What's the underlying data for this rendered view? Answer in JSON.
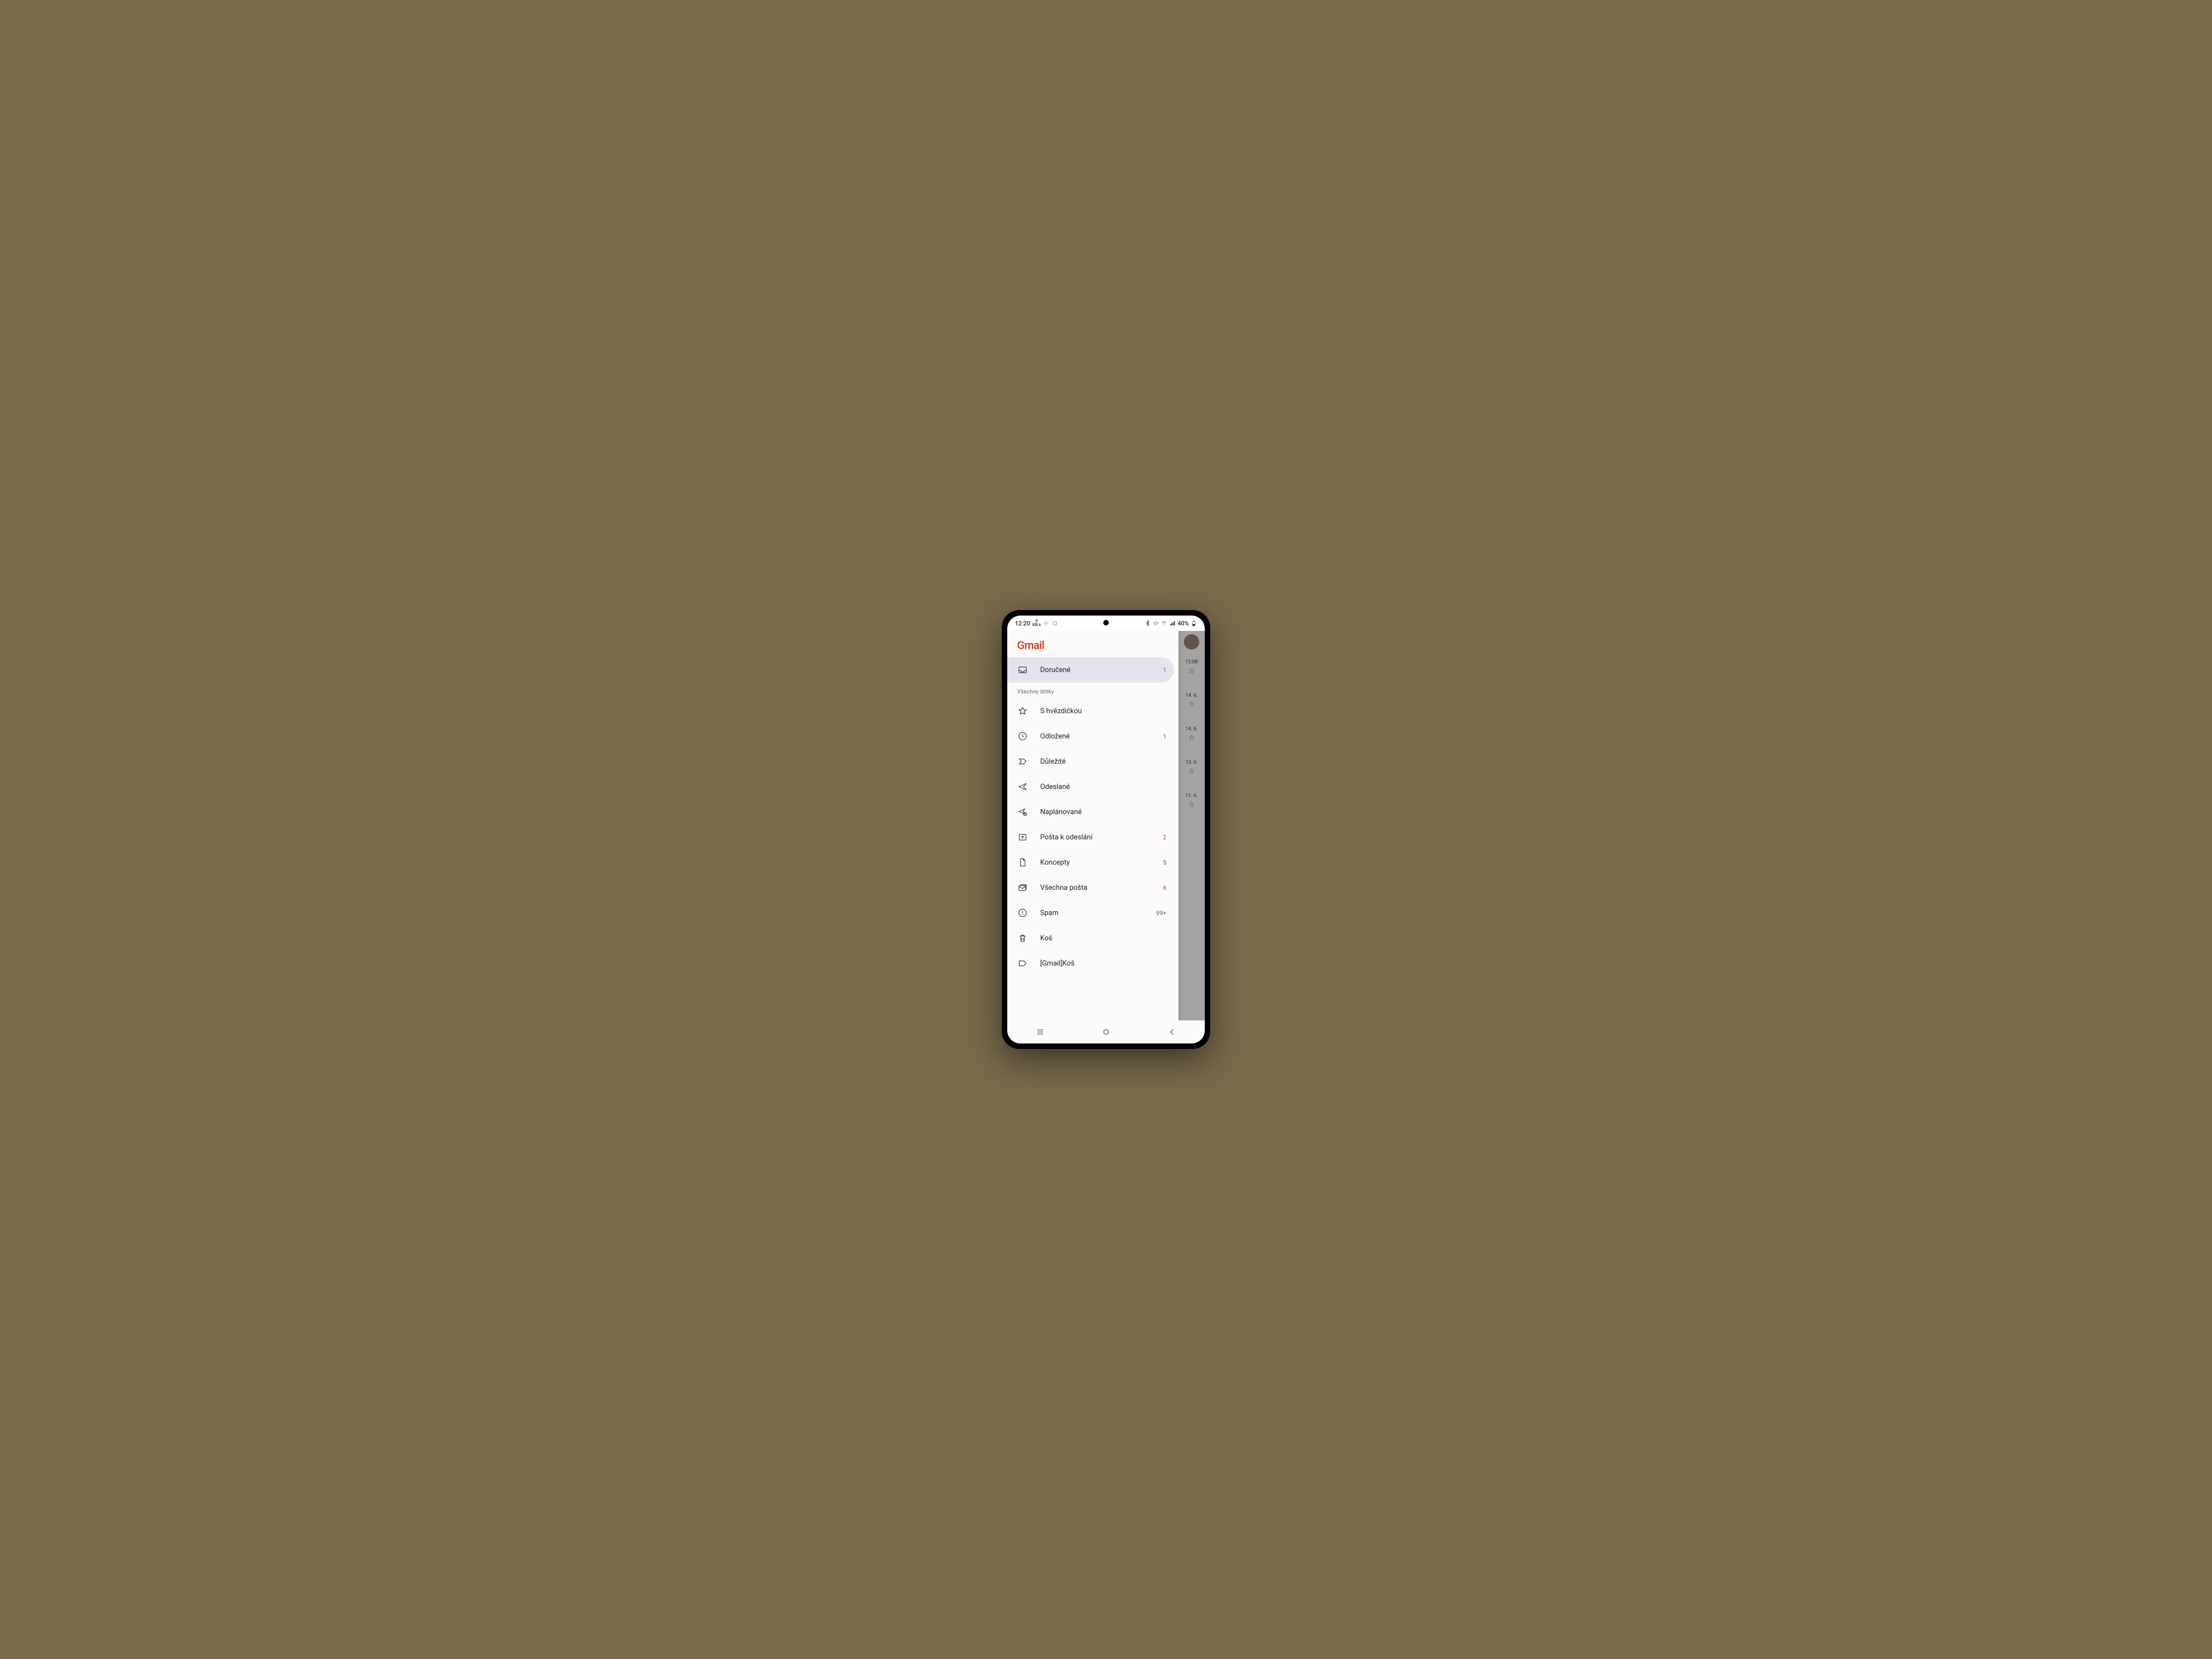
{
  "status": {
    "time": "12:20",
    "net_speed_value": "0",
    "net_speed_unit": "KB/s",
    "battery_text": "40%"
  },
  "app": {
    "title": "Gmail"
  },
  "drawer": {
    "primary": {
      "icon": "inbox-icon",
      "label": "Doručené",
      "count": "1"
    },
    "section_label": "Všechny štítky",
    "items": [
      {
        "icon": "star-icon",
        "label": "S hvězdičkou",
        "count": ""
      },
      {
        "icon": "clock-icon",
        "label": "Odložené",
        "count": "1"
      },
      {
        "icon": "important-icon",
        "label": "Důležité",
        "count": ""
      },
      {
        "icon": "send-icon",
        "label": "Odeslané",
        "count": ""
      },
      {
        "icon": "schedule-send-icon",
        "label": "Naplánované",
        "count": ""
      },
      {
        "icon": "outbox-icon",
        "label": "Pošta k odeslání",
        "count": "2",
        "alert": true
      },
      {
        "icon": "draft-icon",
        "label": "Koncepty",
        "count": "5"
      },
      {
        "icon": "all-mail-icon",
        "label": "Všechna pošta",
        "count": "6",
        "alert": true
      },
      {
        "icon": "spam-icon",
        "label": "Spam",
        "count": "99+"
      },
      {
        "icon": "trash-icon",
        "label": "Koš",
        "count": ""
      },
      {
        "icon": "label-icon",
        "label": "[Gmail]Koš",
        "count": ""
      }
    ]
  },
  "behind": {
    "items": [
      {
        "date": "12:08"
      },
      {
        "date": "14. 6."
      },
      {
        "date": "14. 6."
      },
      {
        "date": "13. 6."
      },
      {
        "date": "11. 6."
      }
    ]
  }
}
